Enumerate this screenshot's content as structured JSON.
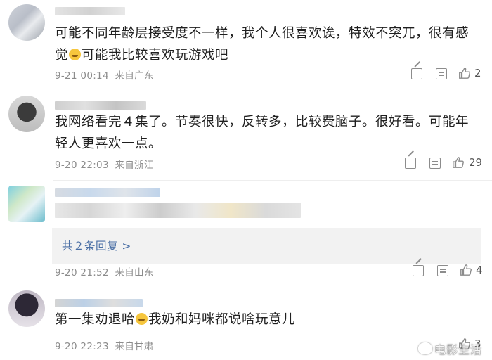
{
  "comments": [
    {
      "text_parts": [
        "可能不同年龄层接受度不一样，我个人很喜欢诶，特效不突兀，很有感觉",
        "可能我比较喜欢玩游戏吧"
      ],
      "time": "9-21 00:14",
      "location": "来自广东",
      "likes": "2"
    },
    {
      "text_parts": [
        "我网络看完４集了。节奏很快，反转多，比较费脑子。很好看。可能年轻人更喜欢一点。"
      ],
      "time": "9-20 22:03",
      "location": "来自浙江",
      "likes": "29"
    },
    {
      "reply_link": "共２条回复 >",
      "time": "9-20 21:52",
      "location": "来自山东",
      "likes": "4"
    },
    {
      "text_parts": [
        "第一集劝退哈",
        "我奶和妈咪都说啥玩意儿"
      ],
      "time": "9-20 22:23",
      "location": "来自甘肃",
      "likes": "3"
    }
  ],
  "icons": [
    "share-icon",
    "comment-icon",
    "like-icon",
    "grin-emoji-icon",
    "weibo-logo-icon"
  ],
  "watermark": "电影生活",
  "colors": {
    "link": "#4a6fa5",
    "meta": "#8c8c8c",
    "reply_bg": "#f2f2f2"
  }
}
